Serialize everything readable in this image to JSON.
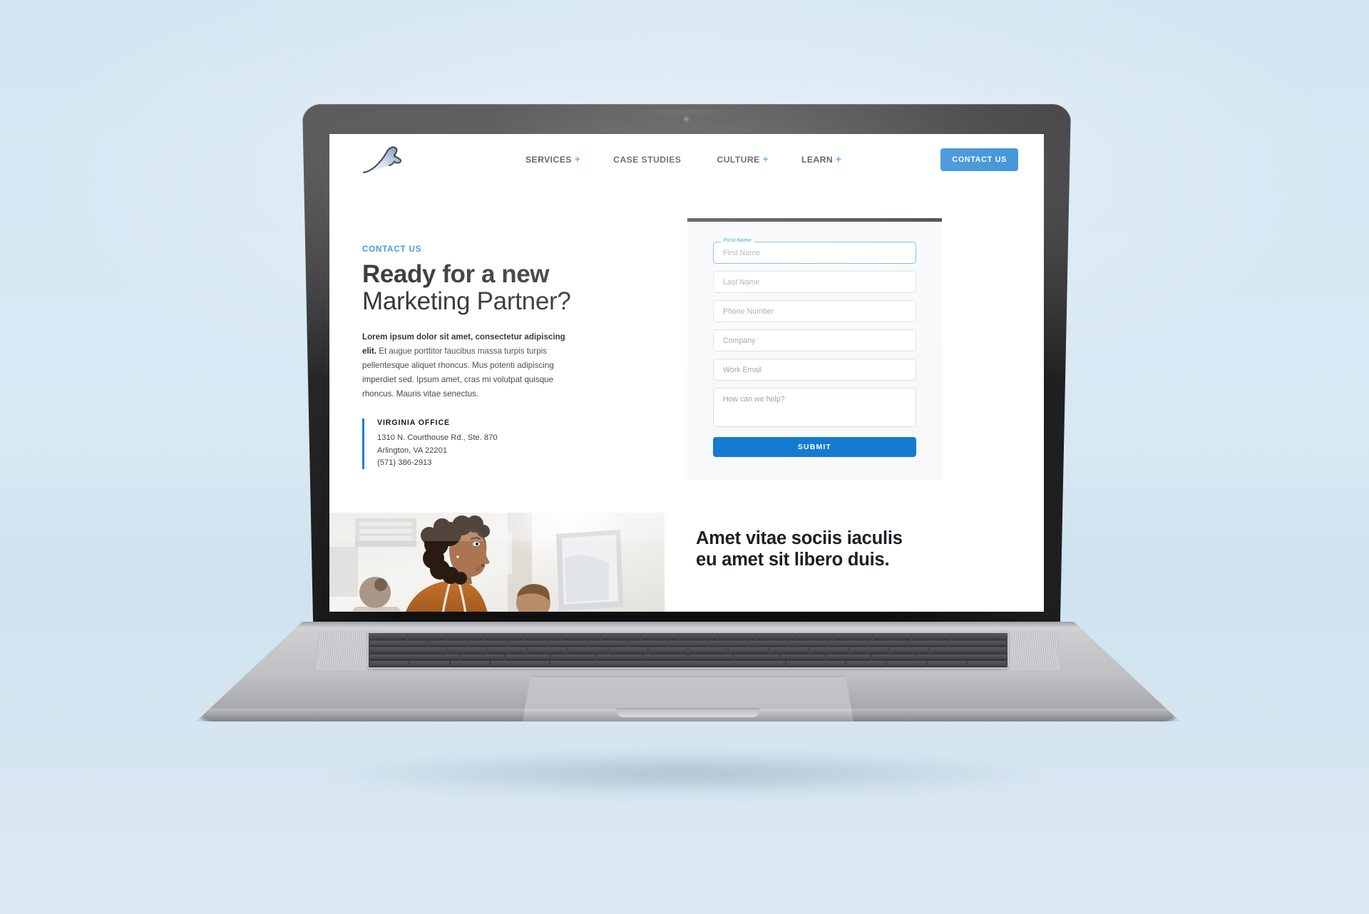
{
  "device": {
    "type": "laptop-mockup",
    "background_color": "#d9e8f2"
  },
  "header": {
    "logo_name": "company-logo",
    "nav": [
      {
        "label": "SERVICES",
        "has_plus": true,
        "plus": "+"
      },
      {
        "label": "CASE STUDIES",
        "has_plus": false,
        "plus": ""
      },
      {
        "label": "CULTURE",
        "has_plus": true,
        "plus": "+"
      },
      {
        "label": "LEARN",
        "has_plus": true,
        "plus": "+"
      }
    ],
    "cta_label": "CONTACT US"
  },
  "contact": {
    "eyebrow": "CONTACT US",
    "headline_bold": "Ready for a new",
    "headline_light": "Marketing Partner?",
    "body_lead": "Lorem ipsum dolor sit amet, consectetur adipiscing elit.",
    "body_rest": " Et augue porttitor faucibus massa turpis turpis pellentesque aliquet rhoncus. Mus potenti adipiscing imperdiet sed. Ipsum amet, cras mi volutpat quisque rhoncus. Mauris vitae senectus.",
    "office": {
      "name": "VIRGINIA OFFICE",
      "street": "1310 N. Courthouse Rd., Ste. 870",
      "city_state_zip": "Arlington, VA 22201",
      "phone": "(571) 386-2913"
    }
  },
  "form": {
    "fields": [
      {
        "name": "first-name",
        "placeholder": "First Name",
        "value": "",
        "floating_label": "First Name",
        "focused": true
      },
      {
        "name": "last-name",
        "placeholder": "Last Name",
        "value": "",
        "floating_label": "",
        "focused": false
      },
      {
        "name": "phone-number",
        "placeholder": "Phone Number",
        "value": "",
        "floating_label": "",
        "focused": false
      },
      {
        "name": "company",
        "placeholder": "Company",
        "value": "",
        "floating_label": "",
        "focused": false
      },
      {
        "name": "work-email",
        "placeholder": "Work Email",
        "value": "",
        "floating_label": "",
        "focused": false
      },
      {
        "name": "message",
        "placeholder": "How can we help?",
        "value": "",
        "floating_label": "",
        "focused": false
      }
    ],
    "submit_label": "SUBMIT"
  },
  "bottom_band": {
    "photo_alt": "office-team-photo",
    "heading_line1": "Amet vitae sociis iaculis",
    "heading_line2": "eu amet sit libero duis."
  },
  "colors": {
    "accent_blue": "#147bd1",
    "link_blue": "#1b7fd4",
    "plus_blue": "#1b8bea",
    "text_dark": "#16181c",
    "text_body": "#3e4349",
    "panel_bg": "#f7f8fa",
    "panel_rule": "#1c1f24",
    "placeholder": "#9aa0a6"
  }
}
